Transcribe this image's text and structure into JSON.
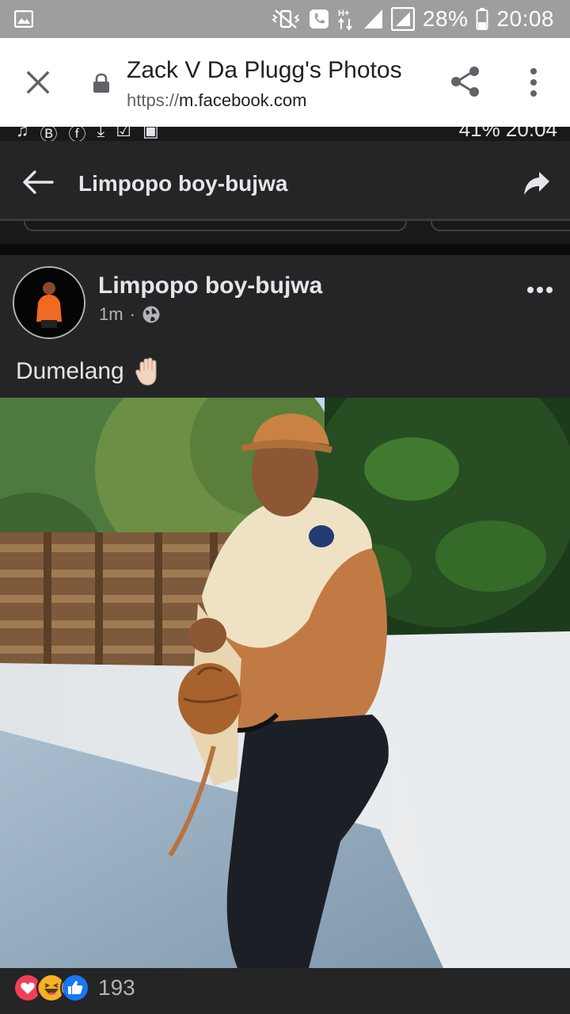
{
  "status_bar": {
    "battery_percent": "28%",
    "time": "20:08",
    "network": "H+",
    "icons": [
      "gallery-icon",
      "mute-vibrate-icon",
      "call-icon",
      "data-arrows-icon",
      "signal-icon",
      "battery-icon"
    ]
  },
  "toolbar": {
    "title": "Zack V Da Plugg's Photos",
    "url_scheme": "https://",
    "url_host": "m.facebook.com",
    "icons": [
      "close-icon",
      "lock-icon",
      "share-icon",
      "more-vert-icon"
    ]
  },
  "inner_status": {
    "text": "41%  20:04"
  },
  "inner_app": {
    "title": "Limpopo boy-bujwa"
  },
  "post": {
    "author": "Limpopo boy-bujwa",
    "time": "1m",
    "dot": "·",
    "text": "Dumelang",
    "emoji": "raised-hand",
    "reaction_count": "193",
    "reactions": [
      "love",
      "haha",
      "like"
    ]
  },
  "colors": {
    "status_bar": "#9e9e9e",
    "toolbar_bg": "#ffffff",
    "app_bg": "#242526",
    "text_primary": "#e4e6eb",
    "text_secondary": "#b0b3b8",
    "love": "#f33e58",
    "haha": "#f7b125",
    "like": "#1877f2"
  }
}
